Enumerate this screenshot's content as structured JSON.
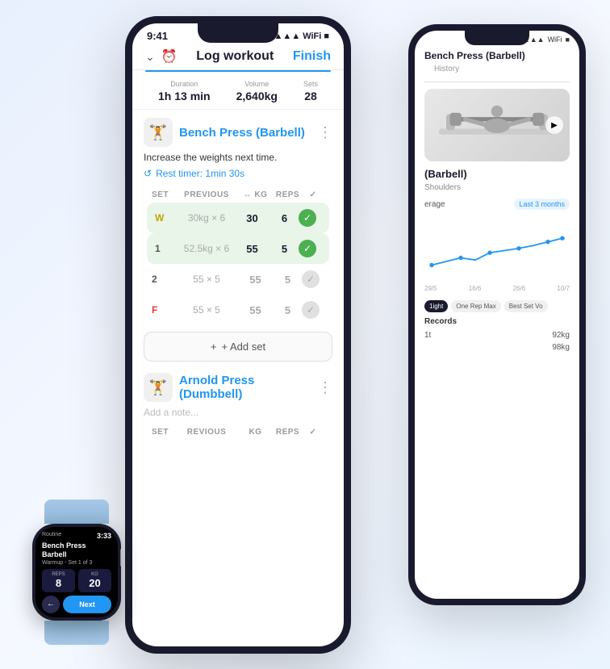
{
  "back_phone": {
    "status": {
      "signal": "▲▲▲",
      "wifi": "wifi",
      "battery": "■"
    },
    "title": "Bench Press (Barbell)",
    "tabs": [
      "",
      "History"
    ],
    "exercise_img_alt": "Bench press illustration",
    "exercise_name": "(Barbell)",
    "muscle": "Shoulders",
    "chart": {
      "period": "Last 3 months",
      "dates": [
        "29/5",
        "16/6",
        "26/6",
        "10/7"
      ]
    },
    "stat_tabs": [
      "1ight",
      "One Rep Max",
      "Best Set Vo"
    ],
    "records_title": "Records",
    "records": [
      {
        "label": "1t",
        "value": "92kg"
      },
      {
        "label": "",
        "value": "98kg"
      }
    ]
  },
  "main_phone": {
    "time": "9:41",
    "header": {
      "title": "Log workout",
      "finish": "Finish"
    },
    "stats": [
      {
        "label": "Duration",
        "value": "1h 13 min"
      },
      {
        "label": "Volume",
        "value": "2,640kg"
      },
      {
        "label": "Sets",
        "value": "28"
      }
    ],
    "exercise1": {
      "name": "Bench Press (Barbell)",
      "feedback": "Increase the weights next time.",
      "rest_timer": "Rest timer: 1min 30s",
      "columns": [
        "SET",
        "PREVIOUS",
        "↔ KG",
        "REPS",
        "✓"
      ],
      "sets": [
        {
          "num": "W",
          "type": "warmup",
          "prev": "30kg × 6",
          "kg": "30",
          "reps": "6",
          "done": true
        },
        {
          "num": "1",
          "type": "completed",
          "prev": "52.5kg × 6",
          "kg": "55",
          "reps": "5",
          "done": true
        },
        {
          "num": "2",
          "type": "normal",
          "prev": "55 × 5",
          "kg": "55",
          "reps": "5",
          "done": false
        },
        {
          "num": "F",
          "type": "failure",
          "prev": "55 × 5",
          "kg": "55",
          "reps": "5",
          "done": false
        }
      ],
      "add_set": "+ Add set"
    },
    "exercise2": {
      "name": "Arnold Press (Dumbbell)",
      "note_placeholder": "Add a note...",
      "columns": [
        "SET",
        "REVIOUS",
        "KG",
        "REPS",
        "✓"
      ]
    }
  },
  "watch": {
    "app": "Routine",
    "time": "3:33",
    "exercise": "Bench Press Barbell",
    "set_info": "Warmup - Set 1 of 3",
    "stats": [
      {
        "label": "REPS",
        "value": "8"
      },
      {
        "label": "KG",
        "value": "20"
      }
    ],
    "back_label": "←",
    "next_label": "Next"
  },
  "icons": {
    "chevron_down": "⌄",
    "clock": "⏰",
    "more": "⋮",
    "rest": "↺",
    "plus": "+",
    "check": "✓",
    "play": "▶"
  }
}
